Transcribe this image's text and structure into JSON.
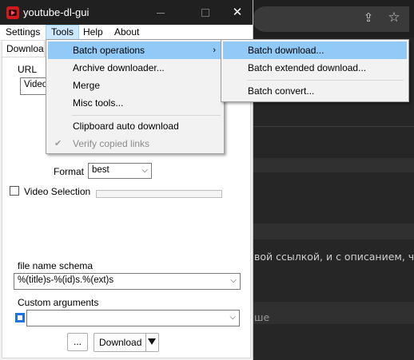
{
  "window": {
    "title": "youtube-dl-gui",
    "close_glyph": "✕"
  },
  "menubar": {
    "items": [
      "Settings",
      "Tools",
      "Help",
      "About"
    ],
    "active": "Tools"
  },
  "tab": {
    "label": "Downloa"
  },
  "form": {
    "url_label": "URL",
    "url_value": "Video",
    "format_label": "Format",
    "format_value": "best",
    "video_selection_label": "Video Selection",
    "video_selection_checked": false,
    "file_name_schema_label": "file name schema",
    "file_name_schema_value": "%(title)s-%(id)s.%(ext)s",
    "custom_arguments_label": "Custom arguments",
    "custom_arguments_value": "",
    "custom_arguments_enabled": true,
    "more_button": "...",
    "download_button": "Download"
  },
  "tools_menu": {
    "items": [
      {
        "label": "Batch operations",
        "has_submenu": true,
        "highlighted": true
      },
      {
        "label": "Archive downloader...",
        "has_submenu": false
      },
      {
        "label": "Merge",
        "has_submenu": false
      },
      {
        "label": "Misc tools...",
        "has_submenu": false
      },
      {
        "label": "Clipboard auto download",
        "has_submenu": false
      },
      {
        "label": "Verify copied links",
        "disabled": true,
        "checked": true
      }
    ]
  },
  "batch_submenu": {
    "items": [
      {
        "label": "Batch download...",
        "highlighted": true
      },
      {
        "label": "Batch extended download..."
      },
      {
        "label": "Batch convert..."
      }
    ]
  },
  "background": {
    "text_line_1": "вой ссылкой, и с описанием, ч",
    "text_line_2": "ше"
  },
  "colors": {
    "titlebar": "#202020",
    "menu_highlight": "#91c9f7",
    "menubar_active": "#cce8ff",
    "browser_bg": "#262626"
  }
}
